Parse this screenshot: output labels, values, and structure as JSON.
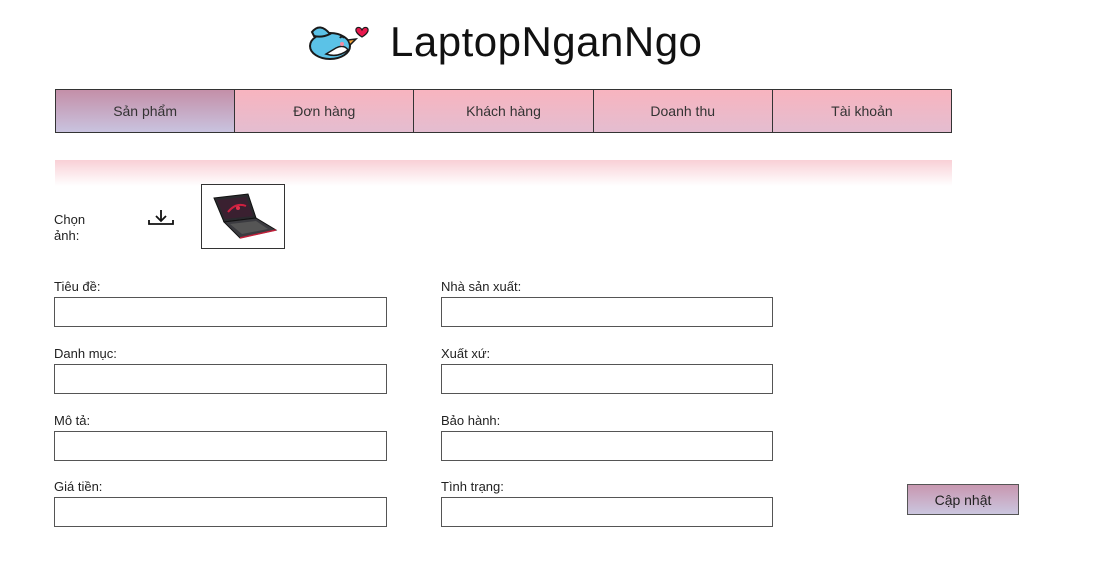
{
  "brand": {
    "name": "LaptopNganNgo",
    "logo_icon": "bird-heart-icon"
  },
  "nav": {
    "items": [
      {
        "label": "Sản phẩm",
        "active": true
      },
      {
        "label": "Đơn hàng",
        "active": false
      },
      {
        "label": "Khách hàng",
        "active": false
      },
      {
        "label": "Doanh thu",
        "active": false
      },
      {
        "label": "Tài khoản",
        "active": false
      }
    ]
  },
  "image_picker": {
    "label": "Chọn ảnh:",
    "upload_icon": "download-icon",
    "thumbnail_icon": "laptop-image"
  },
  "form": {
    "title_label": "Tiêu đề:",
    "title_value": "",
    "manufacturer_label": "Nhà sản xuất:",
    "manufacturer_value": "",
    "category_label": "Danh mục:",
    "category_value": "",
    "origin_label": "Xuất xứ:",
    "origin_value": "",
    "description_label": "Mô tả:",
    "description_value": "",
    "warranty_label": "Bảo hành:",
    "warranty_value": "",
    "price_label": "Giá tiền:",
    "price_value": "",
    "status_label": "Tình trạng:",
    "status_value": "",
    "update_button": "Cập nhật"
  },
  "colors": {
    "nav_gradient_top": "#f8b4bf",
    "nav_gradient_bottom": "#e4bdd0",
    "nav_active_top": "#c48fa8",
    "nav_active_bottom": "#c9c3df",
    "strip": "#f9d0d6"
  }
}
